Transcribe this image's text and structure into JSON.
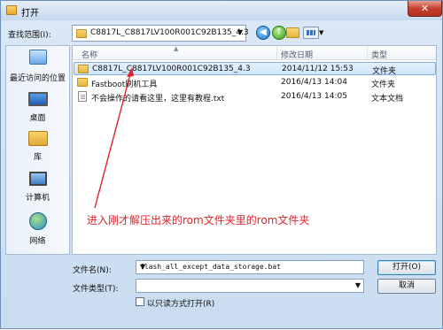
{
  "window": {
    "title": "打开",
    "close_glyph": "✕"
  },
  "toolbar": {
    "lookin_label": "查找范围(I):",
    "lookin_value": "C8817L_C8817LV100R001C92B135_4.3",
    "dropdown_glyph": "▼",
    "back_glyph": "◀",
    "up_glyph": "↑",
    "view_menu_glyph": "▼"
  },
  "places": [
    {
      "label": "最近访问的位置",
      "icon": "recent-places-icon"
    },
    {
      "label": "桌面",
      "icon": "desktop-icon"
    },
    {
      "label": "库",
      "icon": "library-icon"
    },
    {
      "label": "计算机",
      "icon": "computer-icon"
    },
    {
      "label": "网络",
      "icon": "network-icon"
    }
  ],
  "columns": {
    "name": "名称",
    "date": "修改日期",
    "type": "类型",
    "sort_glyph": "▲"
  },
  "files": [
    {
      "name": "C8817L_C8817LV100R001C92B135_4.3",
      "date": "2014/11/12 15:53",
      "type": "文件夹",
      "icon": "folder-icon",
      "selected": true
    },
    {
      "name": "Fastboot刷机工具",
      "date": "2016/4/13 14:04",
      "type": "文件夹",
      "icon": "folder-icon",
      "selected": false
    },
    {
      "name": "不会操作的请看这里，这里有教程.txt",
      "date": "2016/4/13 14:05",
      "type": "文本文档",
      "icon": "text-file-icon",
      "selected": false
    }
  ],
  "annotation": "进入刚才解压出来的rom文件夹里的rom文件夹",
  "bottom": {
    "filename_label": "文件名(N):",
    "filename_value": "flash_all_except_data_storage.bat",
    "filetype_label": "文件类型(T):",
    "filetype_value": "",
    "readonly_label": "以只读方式打开(R)",
    "readonly_checked": false,
    "open_label": "打开(O)",
    "cancel_label": "取消",
    "dropdown_glyph": "▼"
  },
  "colors": {
    "annotation": "#e0242a",
    "selection": "#cfe5fb",
    "title_bar": "#c6d9ef"
  }
}
